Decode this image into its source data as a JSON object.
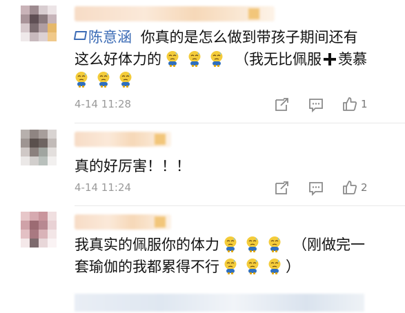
{
  "comments": [
    {
      "mention": "陈意涵",
      "text_line1": "你真的是怎么做到带孩子期间还有",
      "text_line2_a": "这么好体力的",
      "text_line2_b": "（我无比佩服",
      "text_line2_c": "羡慕",
      "time": "4-14 11:28",
      "likes": "1"
    },
    {
      "text_line1": "真的好厉害！！！",
      "time": "4-14 11:24",
      "likes": "2"
    },
    {
      "text_line1_a": "我真实的佩服你的体力",
      "text_line1_b": "（刚做完一",
      "text_line2_a": "套瑜伽的我都累得不行",
      "text_line2_b": "）"
    }
  ],
  "icons": {
    "mention": "diamond-icon",
    "emoji": "sweat-emoji-icon",
    "repost": "repost-icon",
    "reply": "comment-icon",
    "like": "thumbs-up-icon"
  },
  "colors": {
    "mention": "#3b6bb5",
    "meta": "#9a9a9a"
  }
}
